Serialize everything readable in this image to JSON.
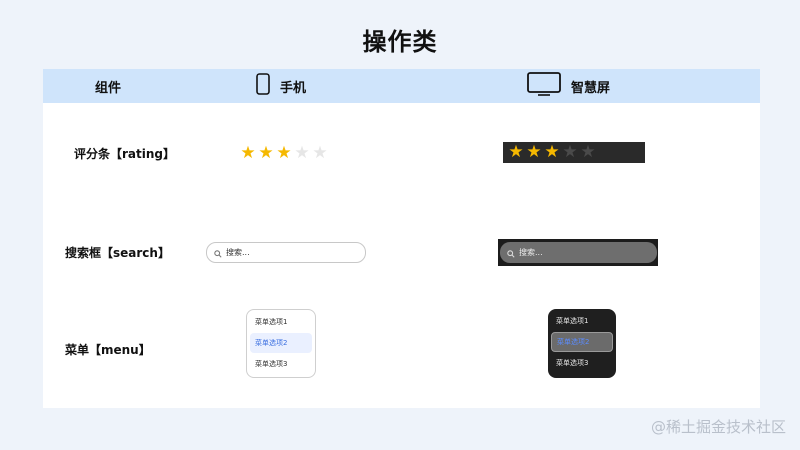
{
  "page_title": "操作类",
  "header": {
    "col_component": "组件",
    "col_phone": "手机",
    "col_tv": "智慧屏"
  },
  "rows": {
    "rating": {
      "label": "评分条【rating】",
      "filled": 3,
      "total": 5
    },
    "search": {
      "label": "搜索框【search】",
      "placeholder": "搜索..."
    },
    "menu": {
      "label": "菜单【menu】",
      "items": [
        "菜单选项1",
        "菜单选项2",
        "菜单选项3"
      ],
      "selected_index": 1
    }
  },
  "icons": {
    "phone": "phone-icon",
    "tv": "tv-icon",
    "search": "search-icon",
    "star": "star-icon"
  },
  "colors": {
    "header_bg": "#cfe4fb",
    "star": "#f5b800",
    "accent": "#3b6fe0"
  },
  "watermark": "@稀土掘金技术社区"
}
